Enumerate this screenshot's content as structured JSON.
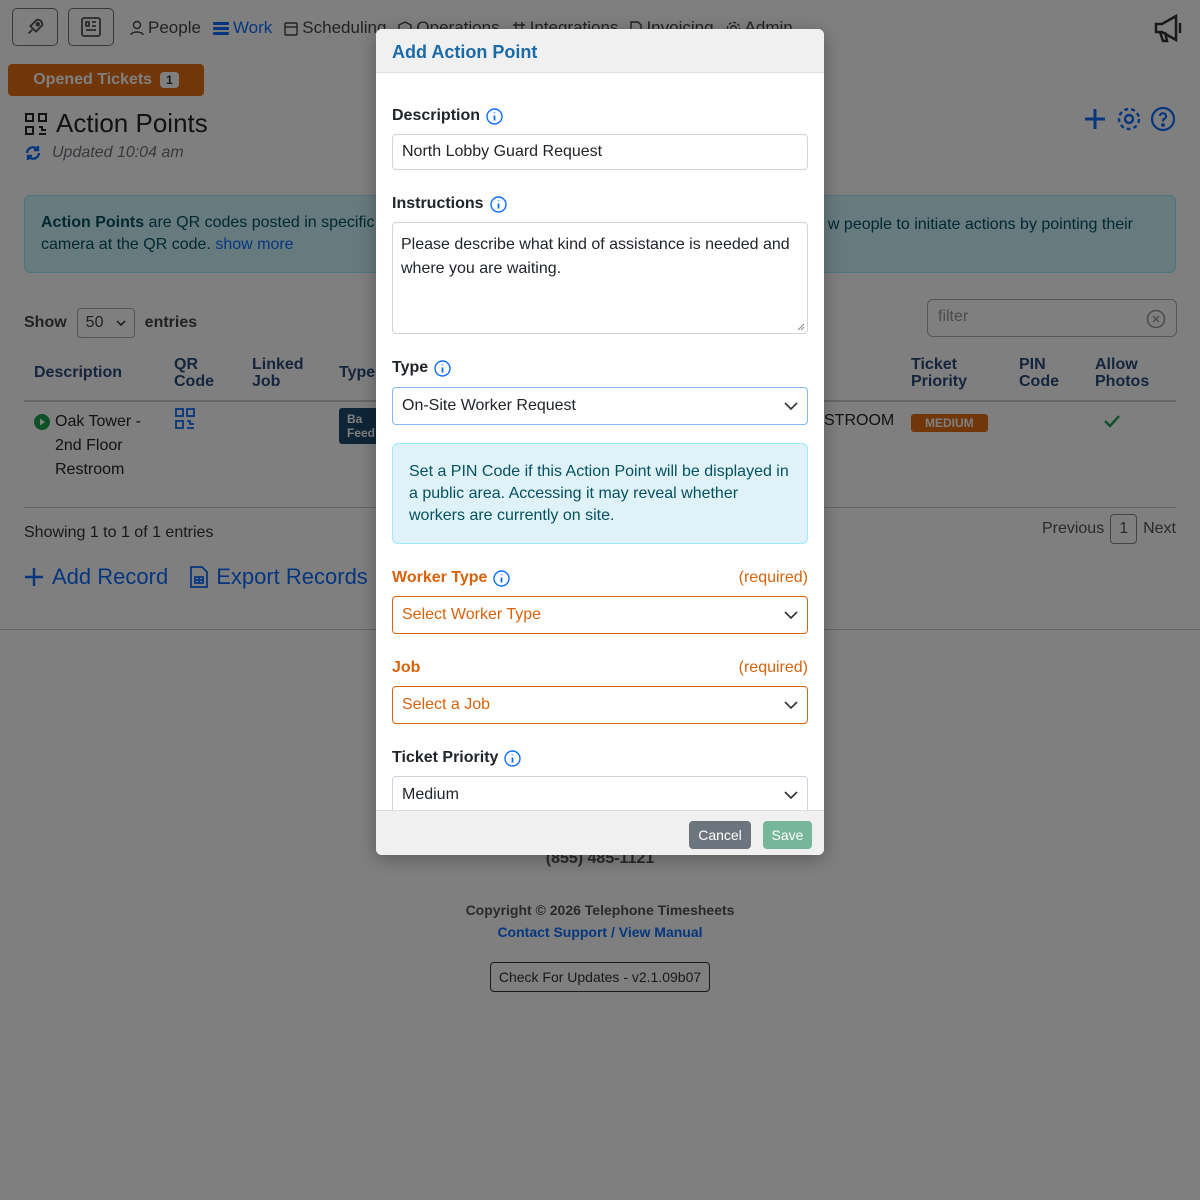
{
  "nav": {
    "items": [
      {
        "label": "People",
        "icon": "person-icon"
      },
      {
        "label": "Work",
        "icon": "stack-icon"
      },
      {
        "label": "Scheduling",
        "icon": "calendar-icon"
      },
      {
        "label": "Operations",
        "icon": "box-icon"
      },
      {
        "label": "Integrations",
        "icon": "hash-icon"
      },
      {
        "label": "Invoicing",
        "icon": "document-icon"
      },
      {
        "label": "Admin",
        "icon": "gear-icon"
      }
    ]
  },
  "tickets": {
    "label": "Opened Tickets",
    "count": "1"
  },
  "page": {
    "title": "Action Points",
    "updated": "Updated 10:04 am"
  },
  "banner": {
    "bold": "Action Points",
    "text": " are QR codes posted in specific",
    "text_right": "w people to initiate actions by pointing their",
    "line2": "camera at the QR code. ",
    "show_more": "show more"
  },
  "table": {
    "show_label": "Show",
    "entries_value": "50",
    "entries_label": "entries",
    "filter_placeholder": "filter",
    "headers": {
      "description": "Description",
      "qr_code": "QR Code",
      "linked_job": "Linked Job",
      "type": "Type",
      "ticket_priority": "Ticket Priority",
      "pin_code": "PIN Code",
      "allow_photos": "Allow Photos"
    },
    "row": {
      "description": "Oak Tower - 2nd Floor Restroom",
      "type_badge": "Ba\nFeed",
      "partial_text": "STROOM",
      "priority": "MEDIUM"
    },
    "showing": "Showing 1 to 1 of 1 entries",
    "pager": {
      "previous": "Previous",
      "page": "1",
      "next": "Next"
    }
  },
  "actions": {
    "add": "Add Record",
    "export": "Export Records"
  },
  "footer": {
    "phone": "(855) 485-1121",
    "copyright": "Copyright © 2026 Telephone Timesheets",
    "contact": "Contact Support",
    "sep": " / ",
    "manual": "View Manual",
    "update": "Check For Updates - v2.1.09b07"
  },
  "modal": {
    "title": "Add Action Point",
    "description_label": "Description",
    "description_value": "North Lobby Guard Request",
    "instructions_label": "Instructions",
    "instructions_value": "Please describe what kind of assistance is needed and where you are waiting.",
    "type_label": "Type",
    "type_value": "On-Site Worker Request",
    "pin_note": "Set a PIN Code if this Action Point will be displayed in a public area. Accessing it may reveal whether workers are currently on site.",
    "worker_type_label": "Worker Type",
    "worker_type_placeholder": "Select Worker Type",
    "job_label": "Job",
    "job_placeholder": "Select a Job",
    "required_note": "(required)",
    "priority_label": "Ticket Priority",
    "priority_value": "Medium",
    "cancel": "Cancel",
    "save": "Save"
  },
  "colors": {
    "accent": "#0d6efd",
    "required": "#d9620b",
    "tickets": "#e26f12",
    "save": "#75b798",
    "cancel": "#6c757d"
  }
}
